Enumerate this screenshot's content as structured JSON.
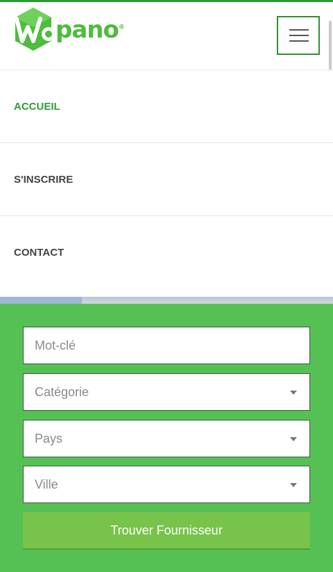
{
  "brand": {
    "logo_text": "Wapano",
    "logo_word": "pano",
    "reg_mark": "®",
    "green": "#4ebc3c"
  },
  "header": {
    "menu_icon": "hamburger-menu-icon"
  },
  "nav": {
    "items": [
      {
        "label": "ACCUEIL",
        "active": true
      },
      {
        "label": "S'INSCRIRE",
        "active": false
      },
      {
        "label": "CONTACT",
        "active": false
      }
    ]
  },
  "search": {
    "keyword_placeholder": "Mot-clé",
    "category_placeholder": "Catégorie",
    "country_placeholder": "Pays",
    "city_placeholder": "Ville",
    "submit_label": "Trouver Fournisseur",
    "panel_color": "#55c155",
    "button_color": "#78c34a"
  }
}
